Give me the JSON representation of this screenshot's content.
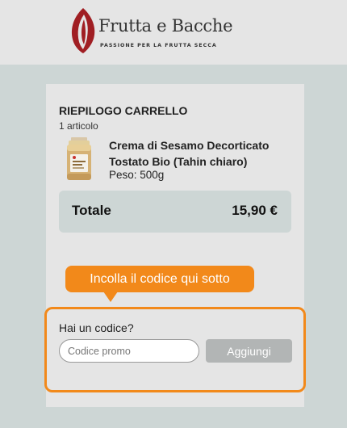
{
  "header": {
    "brand_name": "Frutta e Bacche",
    "tagline": "PASSIONE PER LA FRUTTA SECCA",
    "logo_icon": "almond-leaf-logo",
    "brand_color": "#a01e23"
  },
  "cart": {
    "title": "RIEPILOGO CARRELLO",
    "item_count": "1 articolo",
    "items": [
      {
        "name": "Crema di Sesamo Decorticato Tostato Bio (Tahin chiaro)",
        "weight": "Peso: 500g",
        "image_icon": "tahini-jar-image"
      }
    ],
    "total_label": "Totale",
    "total_value": "15,90 €"
  },
  "callout": {
    "text": "Incolla il codice qui sotto",
    "color": "#f2891a"
  },
  "promo": {
    "question": "Hai un codice?",
    "placeholder": "Codice promo",
    "value": "",
    "button_label": "Aggiungi"
  }
}
